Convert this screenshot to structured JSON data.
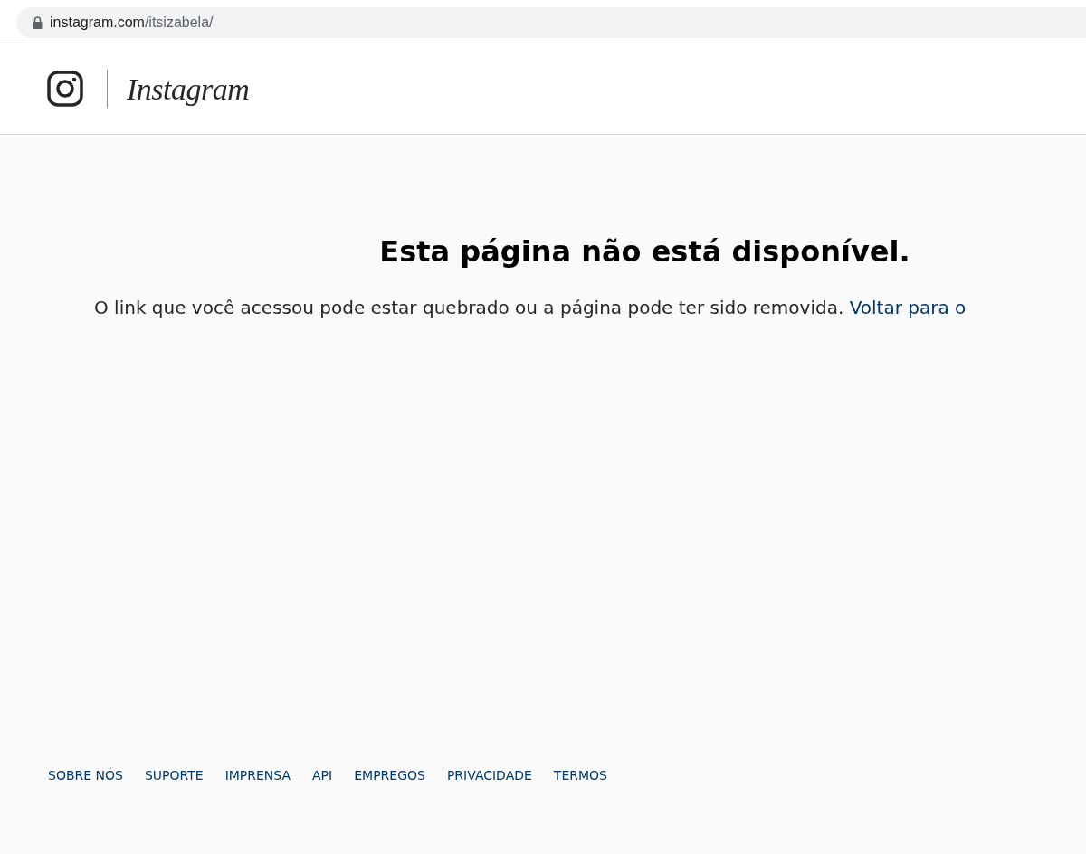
{
  "address_bar": {
    "host": "instagram.com",
    "path": "/itsizabela/"
  },
  "header": {
    "wordmark": "Instagram"
  },
  "error": {
    "title": "Esta página não está disponível.",
    "message": "O link que você acessou pode estar quebrado ou a página pode ter sido removida.",
    "link": "Voltar para o"
  },
  "footer": {
    "links": [
      "SOBRE NÓS",
      "SUPORTE",
      "IMPRENSA",
      "API",
      "EMPREGOS",
      "PRIVACIDADE",
      "TERMOS"
    ]
  }
}
